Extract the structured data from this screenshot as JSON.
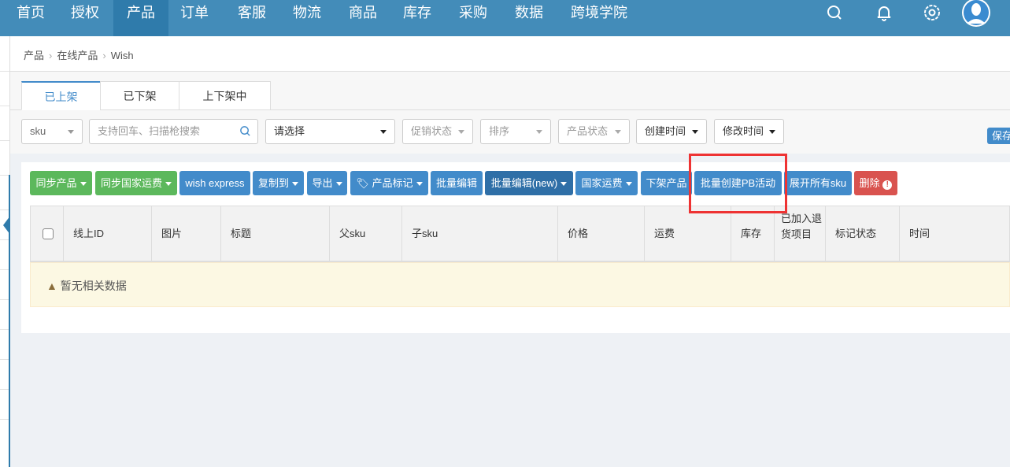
{
  "nav": {
    "items": [
      "首页",
      "授权",
      "产品",
      "订单",
      "客服",
      "物流",
      "商品",
      "库存",
      "采购",
      "数据",
      "跨境学院"
    ],
    "active": "产品",
    "icons": [
      "search-icon",
      "bell-icon",
      "gear-icon",
      "avatar"
    ]
  },
  "breadcrumb": [
    "产品",
    "在线产品",
    "Wish"
  ],
  "tabs": [
    "已上架",
    "已下架",
    "上下架中"
  ],
  "filters": {
    "field": "sku",
    "search_placeholder": "支持回车、扫描枪搜索",
    "select": "请选择",
    "promo": "促销状态",
    "sort": "排序",
    "status": "产品状态",
    "created": "创建时间",
    "modified": "修改时间",
    "save": "保存"
  },
  "actions": [
    "同步产品",
    "同步国家运费",
    "wish express",
    "复制到",
    "导出",
    "产品标记",
    "批量编辑",
    "批量编辑(new)",
    "国家运费",
    "下架产品",
    "批量创建PB活动",
    "展开所有sku",
    "删除"
  ],
  "table": {
    "columns": [
      "线上ID",
      "图片",
      "标题",
      "父sku",
      "子sku",
      "价格",
      "运费",
      "库存",
      "已加入退货项目",
      "标记状态",
      "时间"
    ],
    "empty": "暂无相关数据"
  },
  "colors": {
    "nav": "#438cb9",
    "primary": "#428bca",
    "success": "#5cb85c",
    "danger": "#d9534f",
    "highlight": "#ee3333"
  }
}
